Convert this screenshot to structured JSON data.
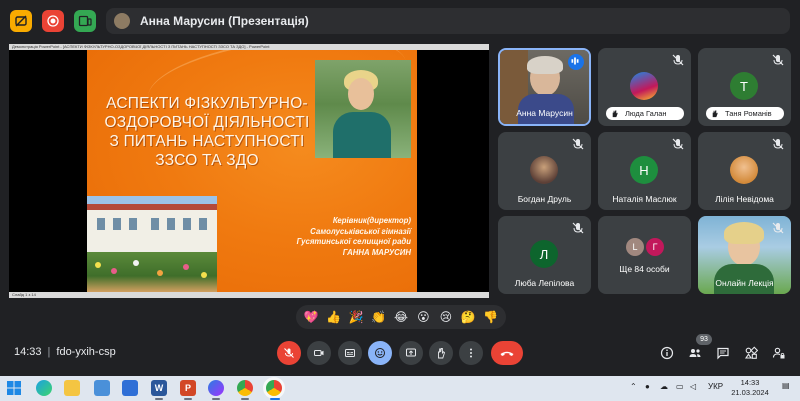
{
  "meeting": {
    "title": "Анна Марусин (Презентація)",
    "time": "14:33",
    "code": "fdo-yxih-csp",
    "participants_count": "93"
  },
  "presentation": {
    "window_title": "Демонстрація PowerPoint - [АСПЕКТИ ФІЗКУЛЬТУРНО-ОЗДОРОВЧОЇ ДІЯЛЬНОСТІ З ПИТАНЬ НАСТУПНОСТІ ЗЗСО ТА ЗДО] - PowerPoint",
    "status": "Слайд 1 з 14",
    "heading_lines": [
      "Аспекти фізкультурно-",
      "оздоровчої діяльності",
      "з питань наступності",
      "ЗЗСО та ЗДО"
    ],
    "author_lines": [
      "Керівник(директор)",
      "Самолуськівської гімназії",
      "Гусятинської селищної ради",
      "ГАННА МАРУСИН"
    ]
  },
  "participants": [
    {
      "name": "Анна Марусин",
      "kind": "video",
      "muted": false
    },
    {
      "name": "Люда Галан",
      "kind": "photo",
      "hand_raised": true,
      "muted": true
    },
    {
      "name": "Таня Романів",
      "kind": "initial",
      "initial": "Т",
      "color": "#2e7d32",
      "hand_raised": true,
      "muted": true
    },
    {
      "name": "Богдан Друль",
      "kind": "photo",
      "muted": true
    },
    {
      "name": "Наталія Маслюк",
      "kind": "initial",
      "initial": "Н",
      "color": "#1e8e3e",
      "muted": true
    },
    {
      "name": "Лілія Невідома",
      "kind": "photo",
      "muted": true
    },
    {
      "name": "Люба Лепілова",
      "kind": "initial",
      "initial": "Л",
      "color": "#0d652d",
      "muted": true
    },
    {
      "name": "Ще 84 особи",
      "kind": "group",
      "initials": [
        "L",
        "Г"
      ]
    },
    {
      "name": "Онлайн Лекція",
      "kind": "video",
      "muted": true
    }
  ],
  "reactions": [
    "💖",
    "👍",
    "🎉",
    "👏",
    "😂",
    "😮",
    "😢",
    "🤔",
    "👎"
  ],
  "taskbar": {
    "lang": "УКР",
    "clock_time": "14:33",
    "clock_date": "21.03.2024"
  },
  "colors": {
    "background": "#202124",
    "tile": "#3c4043",
    "accent_red": "#ea4335",
    "accent_blue": "#8ab4f8"
  }
}
